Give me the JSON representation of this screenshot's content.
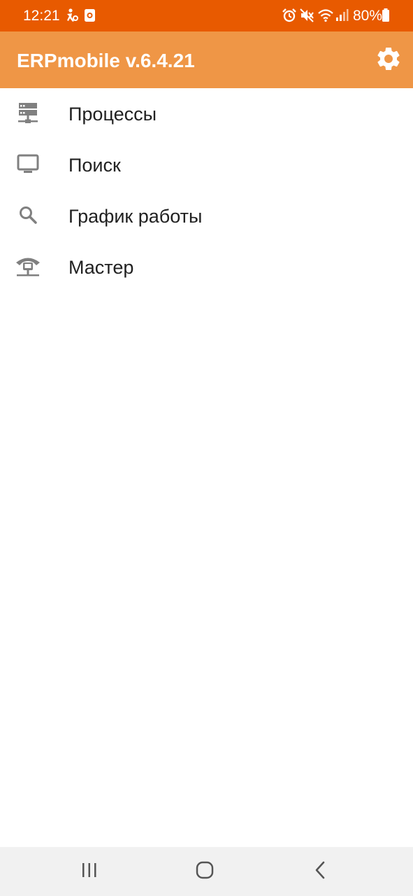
{
  "status_bar": {
    "time": "12:21",
    "battery": "80%",
    "left_icons": [
      "accessibility-icon",
      "notification-app-icon"
    ],
    "right_icons": [
      "alarm-icon",
      "mute-icon",
      "wifi-icon",
      "signal-icon",
      "battery-icon"
    ]
  },
  "app_bar": {
    "title": "ERPmobile v.6.4.21",
    "settings_icon": "gear-icon"
  },
  "menu": {
    "items": [
      {
        "label": "Процессы",
        "icon": "server-icon"
      },
      {
        "label": "Поиск",
        "icon": "monitor-icon"
      },
      {
        "label": "График работы",
        "icon": "search-icon"
      },
      {
        "label": "Мастер",
        "icon": "ip-phone-icon"
      }
    ]
  },
  "nav_bar": {
    "buttons": [
      "recents-icon",
      "home-icon",
      "back-icon"
    ]
  },
  "colors": {
    "status_bar": "#E85A00",
    "app_bar": "#EF9646",
    "text": "#212121",
    "icon": "#808080",
    "nav_bar": "#F1F1F1"
  }
}
